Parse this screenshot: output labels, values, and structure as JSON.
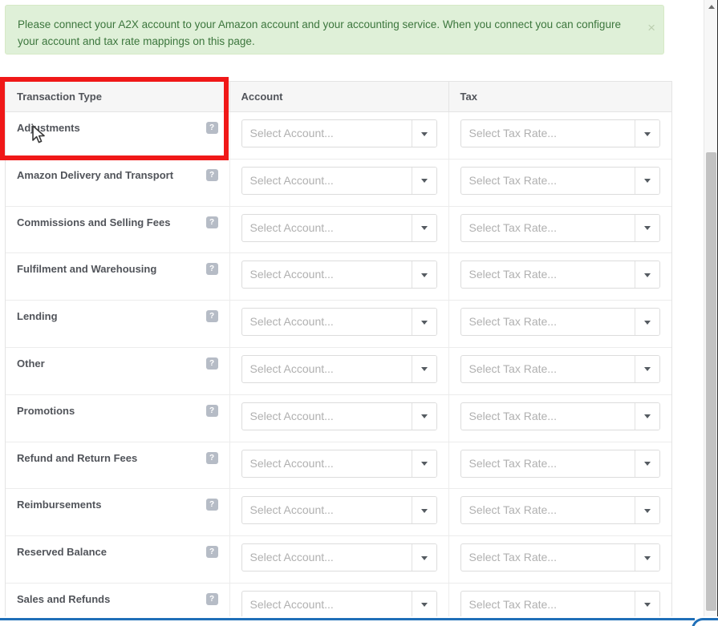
{
  "alert": {
    "message": "Please connect your A2X account to your Amazon account and your accounting service. When you connect you can configure your account and tax rate mappings on this page.",
    "close_label": "×",
    "background_color": "#dff0d8",
    "text_color": "#3c763d"
  },
  "table": {
    "columns": [
      "Transaction Type",
      "Account",
      "Tax"
    ],
    "help_badge_label": "?",
    "account_placeholder": "Select Account...",
    "tax_placeholder": "Select Tax Rate...",
    "rows": [
      {
        "type": "Adjustments",
        "account": "Select Account...",
        "tax": "Select Tax Rate..."
      },
      {
        "type": "Amazon Delivery and Transport",
        "account": "Select Account...",
        "tax": "Select Tax Rate..."
      },
      {
        "type": "Commissions and Selling Fees",
        "account": "Select Account...",
        "tax": "Select Tax Rate..."
      },
      {
        "type": "Fulfilment and Warehousing",
        "account": "Select Account...",
        "tax": "Select Tax Rate..."
      },
      {
        "type": "Lending",
        "account": "Select Account...",
        "tax": "Select Tax Rate..."
      },
      {
        "type": "Other",
        "account": "Select Account...",
        "tax": "Select Tax Rate..."
      },
      {
        "type": "Promotions",
        "account": "Select Account...",
        "tax": "Select Tax Rate..."
      },
      {
        "type": "Refund and Return Fees",
        "account": "Select Account...",
        "tax": "Select Tax Rate..."
      },
      {
        "type": "Reimbursements",
        "account": "Select Account...",
        "tax": "Select Tax Rate..."
      },
      {
        "type": "Reserved Balance",
        "account": "Select Account...",
        "tax": "Select Tax Rate..."
      },
      {
        "type": "Sales and Refunds",
        "account": "Select Account...",
        "tax": "Select Tax Rate..."
      }
    ]
  },
  "annotation": {
    "highlight_color": "#f01818"
  },
  "scrollbar": {
    "thumb_color": "#c2c2c2",
    "track_color": "#f7f7f7"
  }
}
